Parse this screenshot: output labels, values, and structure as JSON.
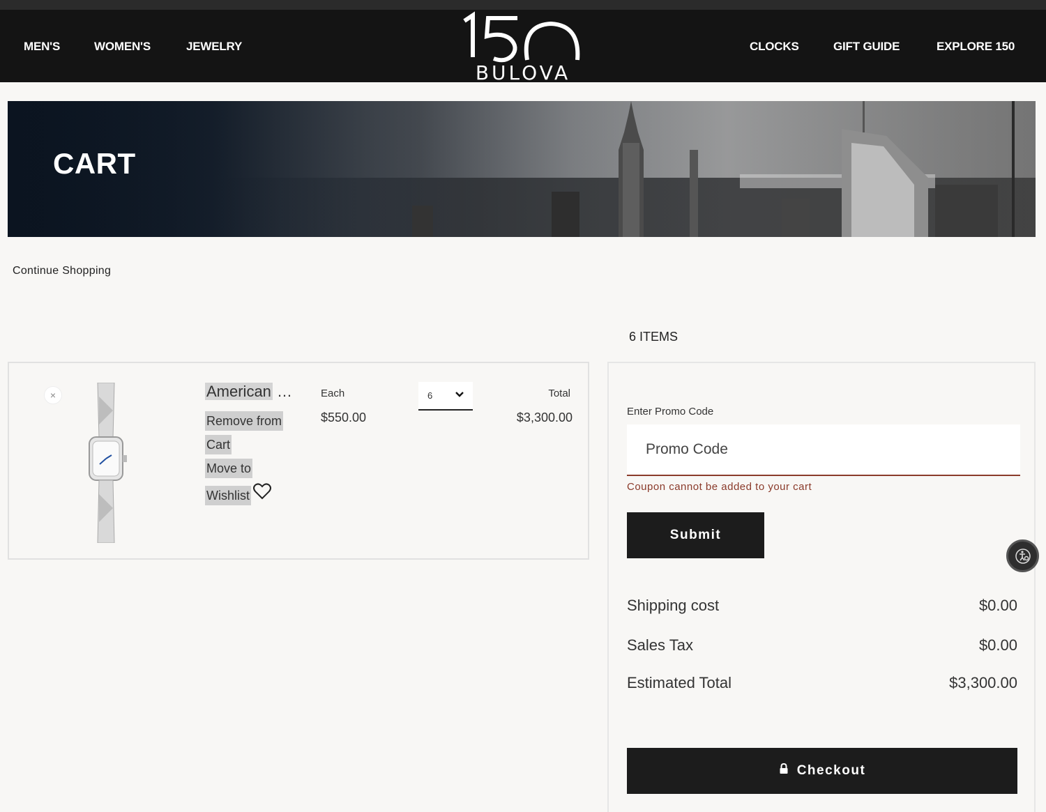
{
  "brand": {
    "logo_number": "150",
    "logo_word": "BULOVA"
  },
  "nav": {
    "left": [
      "MEN'S",
      "WOMEN'S",
      "JEWELRY"
    ],
    "right": [
      "CLOCKS",
      "GIFT GUIDE",
      "EXPLORE 150"
    ]
  },
  "hero": {
    "title": "CART"
  },
  "continue_shopping": "Continue Shopping",
  "items_count": "6 ITEMS",
  "cart_item": {
    "remove_icon": "×",
    "name": "American",
    "name_ellipsis": "…",
    "remove_line1": "Remove from",
    "remove_line2": "Cart",
    "move_line1": "Move to",
    "move_line2": "Wishlist",
    "each_label": "Each",
    "each_price": "$550.00",
    "quantity": "6",
    "total_label": "Total",
    "total_price": "$3,300.00"
  },
  "summary": {
    "promo_label": "Enter Promo Code",
    "promo_placeholder": "Promo Code",
    "promo_error": "Coupon cannot be added to your cart",
    "submit_label": "Submit",
    "shipping_label": "Shipping cost",
    "shipping_value": "$0.00",
    "tax_label": "Sales Tax",
    "tax_value": "$0.00",
    "total_label": "Estimated Total",
    "total_value": "$3,300.00",
    "checkout_label": "Checkout"
  },
  "icons": {
    "close": "close-icon",
    "heart": "heart-icon",
    "chevron": "chevron-down-icon",
    "lock": "lock-icon",
    "accessibility": "accessibility-icon"
  },
  "colors": {
    "header_bg": "#141414",
    "button_bg": "#1c1c1c",
    "error": "#8a3a2a",
    "page_bg": "#f8f7f5"
  }
}
